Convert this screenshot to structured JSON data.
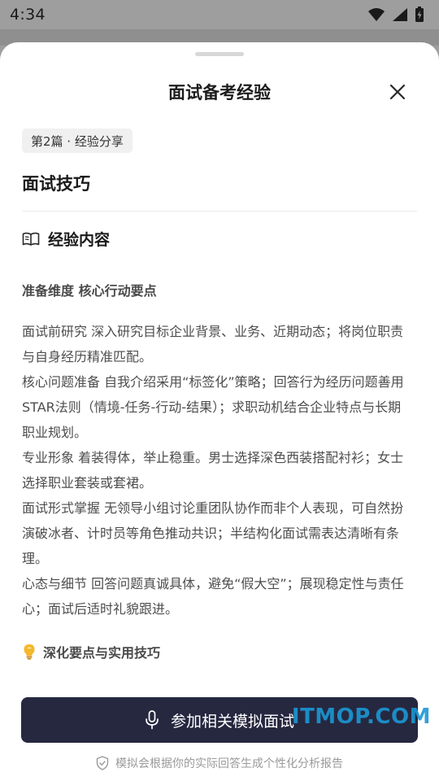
{
  "status_bar": {
    "time": "4:34"
  },
  "sheet": {
    "title": "面试备考经验",
    "tag": "第2篇 · 经验分享",
    "article_title": "面试技巧",
    "section_label": "经验内容",
    "subhead": "准备维度 核心行动要点",
    "paragraphs": [
      "面试前研究 深入研究目标企业背景、业务、近期动态；将岗位职责与自身经历精准匹配。",
      "核心问题准备 自我介绍采用“标签化”策略；回答行为经历问题善用STAR法则（情境-任务-行动-结果）；求职动机结合企业特点与长期职业规划。",
      "专业形象 着装得体，举止稳重。男士选择深色西装搭配衬衫；女士选择职业套装或套裙。",
      "面试形式掌握 无领导小组讨论重团队协作而非个人表现，可自然扮演破冰者、计时员等角色推动共识；半结构化面试需表达清晰有条理。",
      "心态与细节 回答问题真诚具体，避免“假大空”；展现稳定性与责任心；面试后适时礼貌跟进。"
    ],
    "tips_label": "深化要点与实用技巧",
    "cta_label": "参加相关模拟面试",
    "footnote": "模拟会根据你的实际回答生成个性化分析报告"
  },
  "watermark": "ITMOP.COM",
  "colors": {
    "cta": "#262840",
    "watermark": "#1c97d4"
  }
}
